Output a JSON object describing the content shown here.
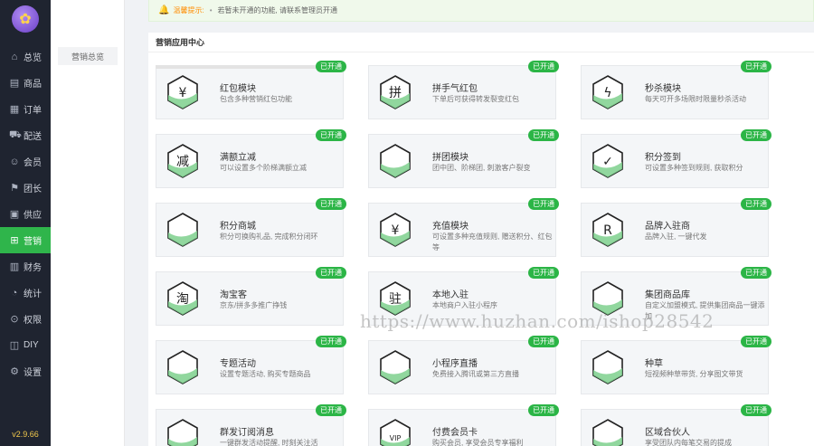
{
  "sidebar": {
    "items": [
      {
        "label": "总览",
        "icon": "home-icon",
        "glyph": "⌂"
      },
      {
        "label": "商品",
        "icon": "product-icon",
        "glyph": "▤"
      },
      {
        "label": "订单",
        "icon": "order-icon",
        "glyph": "▦"
      },
      {
        "label": "配送",
        "icon": "delivery-icon",
        "glyph": "⛟"
      },
      {
        "label": "会员",
        "icon": "member-icon",
        "glyph": "☺"
      },
      {
        "label": "团长",
        "icon": "leader-icon",
        "glyph": "⚑"
      },
      {
        "label": "供应",
        "icon": "supply-icon",
        "glyph": "▣"
      },
      {
        "label": "营销",
        "icon": "marketing-icon",
        "glyph": "⊞"
      },
      {
        "label": "财务",
        "icon": "finance-icon",
        "glyph": "▥"
      },
      {
        "label": "统计",
        "icon": "stats-icon",
        "glyph": "◔"
      },
      {
        "label": "权限",
        "icon": "permission-icon",
        "glyph": "⊙"
      },
      {
        "label": "DIY",
        "icon": "diy-icon",
        "glyph": "◫"
      },
      {
        "label": "设置",
        "icon": "settings-icon",
        "glyph": "⚙"
      }
    ],
    "active_label": "营销",
    "version": "v2.9.66"
  },
  "subnav": {
    "item": "营销总览"
  },
  "notice": {
    "title": "温馨提示:",
    "text": "若暂未开通的功能, 请联系管理员开通"
  },
  "panel": {
    "title": "营销应用中心"
  },
  "cards": [
    {
      "title": "红包模块",
      "desc": "包含多种营销红包功能",
      "status": "已开通",
      "icon": "red-envelope-icon",
      "glyph": "¥"
    },
    {
      "title": "拼手气红包",
      "desc": "下单后可获得转发裂变红包",
      "status": "已开通",
      "icon": "lucky-envelope-icon",
      "glyph": "拼"
    },
    {
      "title": "秒杀模块",
      "desc": "每天可开多场限时限量秒杀活动",
      "status": "已开通",
      "icon": "flash-sale-icon",
      "glyph": "ϟ"
    },
    {
      "title": "满额立减",
      "desc": "可以设置多个阶梯满额立减",
      "status": "已开通",
      "icon": "discount-icon",
      "glyph": "减"
    },
    {
      "title": "拼团模块",
      "desc": "团中团、阶梯团, 刺激客户裂变",
      "status": "已开通",
      "icon": "group-buy-icon",
      "glyph": ""
    },
    {
      "title": "积分签到",
      "desc": "可设置多种签到规则, 获取积分",
      "status": "已开通",
      "icon": "checkin-icon",
      "glyph": "✓"
    },
    {
      "title": "积分商城",
      "desc": "积分可换购礼品, 完成积分闭环",
      "status": "已开通",
      "icon": "gift-icon",
      "glyph": ""
    },
    {
      "title": "充值模块",
      "desc": "可设置多种充值规则, 赠送积分、红包等",
      "status": "已开通",
      "icon": "recharge-icon",
      "glyph": "¥"
    },
    {
      "title": "品牌入驻商",
      "desc": "品牌入驻, 一键代发",
      "status": "已开通",
      "icon": "brand-icon",
      "glyph": "R"
    },
    {
      "title": "淘宝客",
      "desc": "京东/拼多多推广挣钱",
      "status": "已开通",
      "icon": "taoke-icon",
      "glyph": "淘"
    },
    {
      "title": "本地入驻",
      "desc": "本地商户入驻小程序",
      "status": "已开通",
      "icon": "local-store-icon",
      "glyph": "驻"
    },
    {
      "title": "集团商品库",
      "desc": "自定义加盟模式, 提供集团商品一键添加",
      "status": "已开通",
      "icon": "group-library-icon",
      "glyph": ""
    },
    {
      "title": "专题活动",
      "desc": "设置专题活动, 购买专题商品",
      "status": "已开通",
      "icon": "topic-icon",
      "glyph": ""
    },
    {
      "title": "小程序直播",
      "desc": "免费接入腾讯或第三方直播",
      "status": "已开通",
      "icon": "live-icon",
      "glyph": ""
    },
    {
      "title": "种草",
      "desc": "短视频种草带货, 分享图文带货",
      "status": "已开通",
      "icon": "sprout-icon",
      "glyph": ""
    },
    {
      "title": "群发订阅消息",
      "desc": "一键群发活动提醒, 时刻关注活",
      "status": "已开通",
      "icon": "bell-icon",
      "glyph": ""
    },
    {
      "title": "付费会员卡",
      "desc": "购买会员, 享受会员专享福利",
      "status": "已开通",
      "icon": "vip-card-icon",
      "glyph": "VIP"
    },
    {
      "title": "区域合伙人",
      "desc": "享受团队内每笔交易的提成",
      "status": "已开通",
      "icon": "partner-icon",
      "glyph": ""
    }
  ],
  "watermark": "https://www.huzhan.com/ishop28542",
  "colors": {
    "sidebar_bg": "#1f2430",
    "accent": "#2bb546",
    "notice_bg": "#f0f9eb"
  }
}
